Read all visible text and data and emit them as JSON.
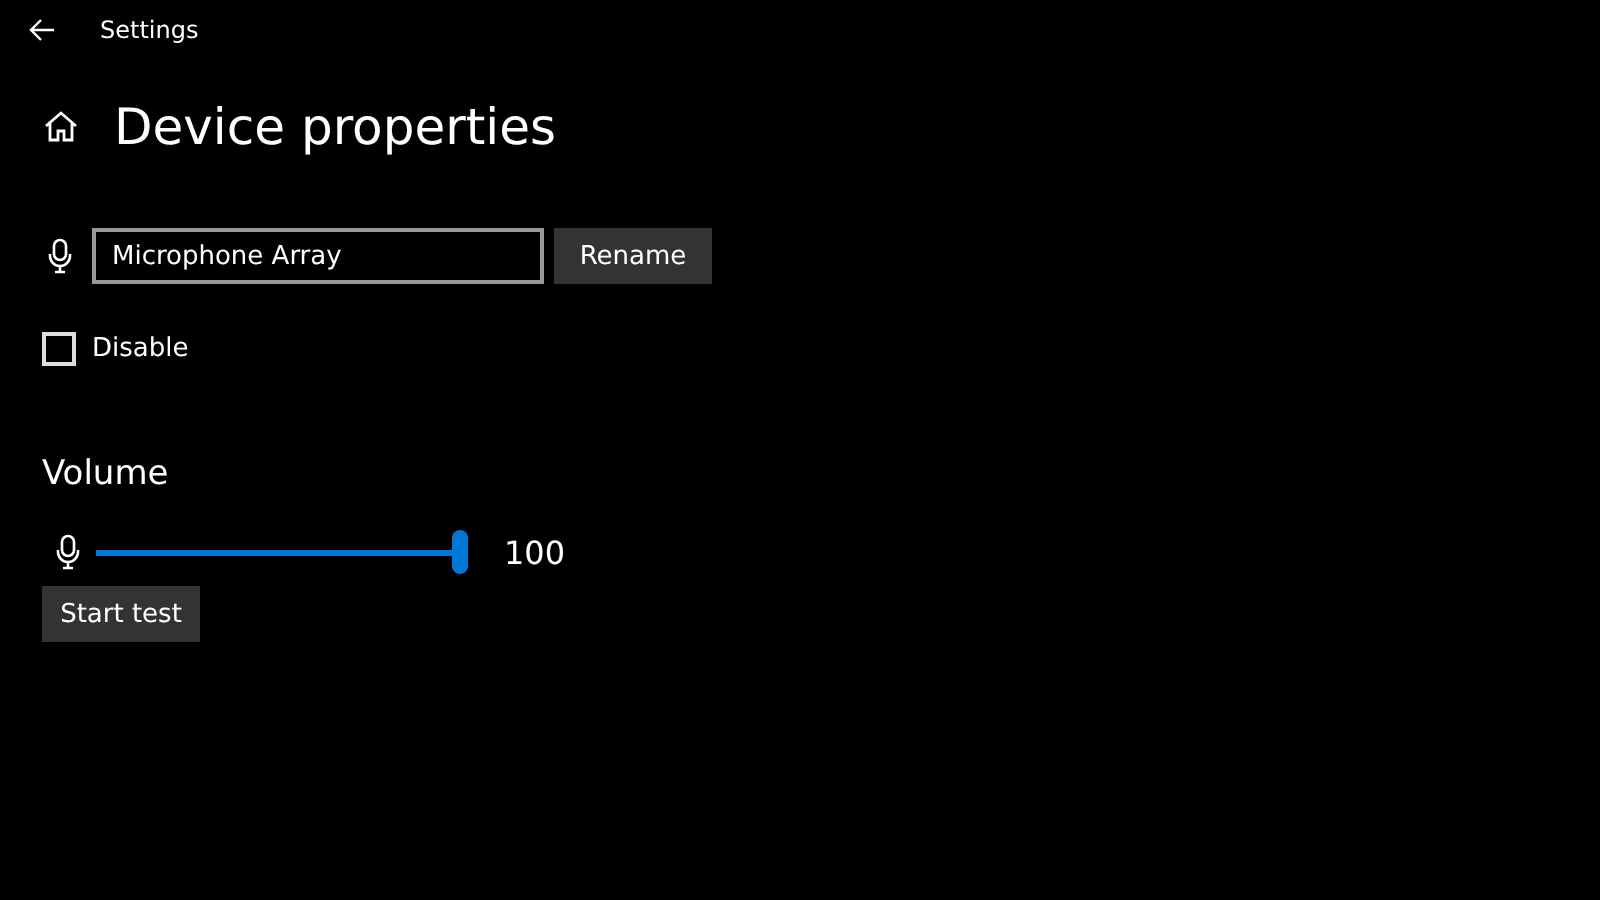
{
  "window": {
    "title": "Settings"
  },
  "header": {
    "title": "Device properties"
  },
  "device_name": {
    "value": "Microphone Array",
    "button": "Rename"
  },
  "disable": {
    "label": "Disable",
    "checked": false
  },
  "volume": {
    "heading": "Volume",
    "level": 1,
    "reading": "100",
    "button": "Start test"
  }
}
